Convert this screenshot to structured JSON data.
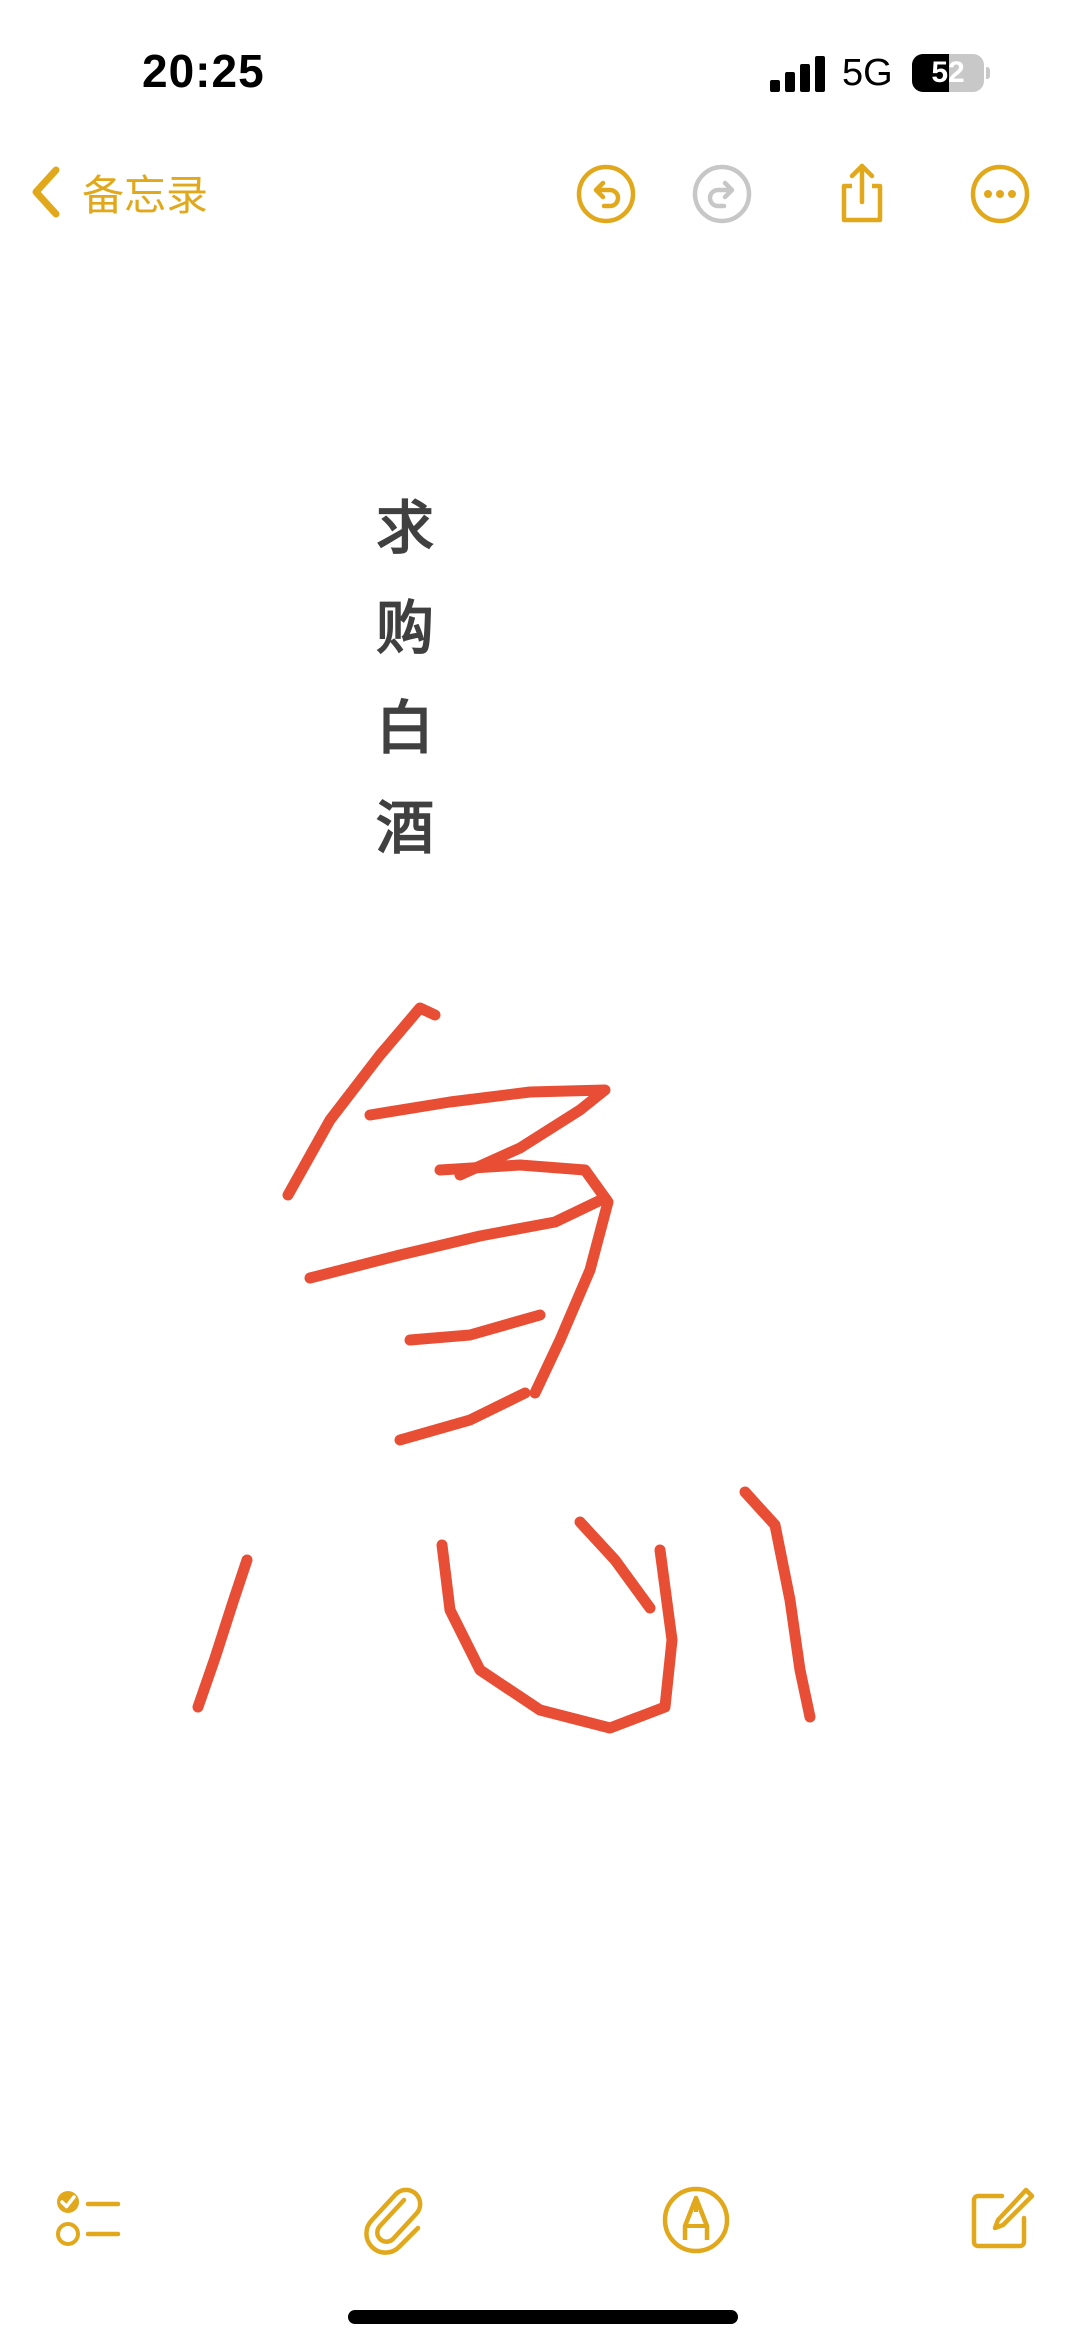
{
  "status_bar": {
    "time": "20:25",
    "network": "5G",
    "battery_percent": 52,
    "battery_label": "52",
    "icons": [
      "signal-bars-icon",
      "battery-icon"
    ]
  },
  "nav": {
    "back_label": "备忘录",
    "icons": [
      "chevron-left-icon",
      "undo-icon",
      "redo-icon",
      "share-icon",
      "more-icon"
    ]
  },
  "note": {
    "typed_text": "求购白酒",
    "ink_color": "#e63b1f"
  },
  "toolbar": {
    "icons": [
      "checklist-icon",
      "attachment-icon",
      "markup-icon",
      "compose-icon"
    ]
  },
  "colors": {
    "accent": "#e2a81c",
    "disabled": "#c7c7c7",
    "text": "#404040"
  }
}
